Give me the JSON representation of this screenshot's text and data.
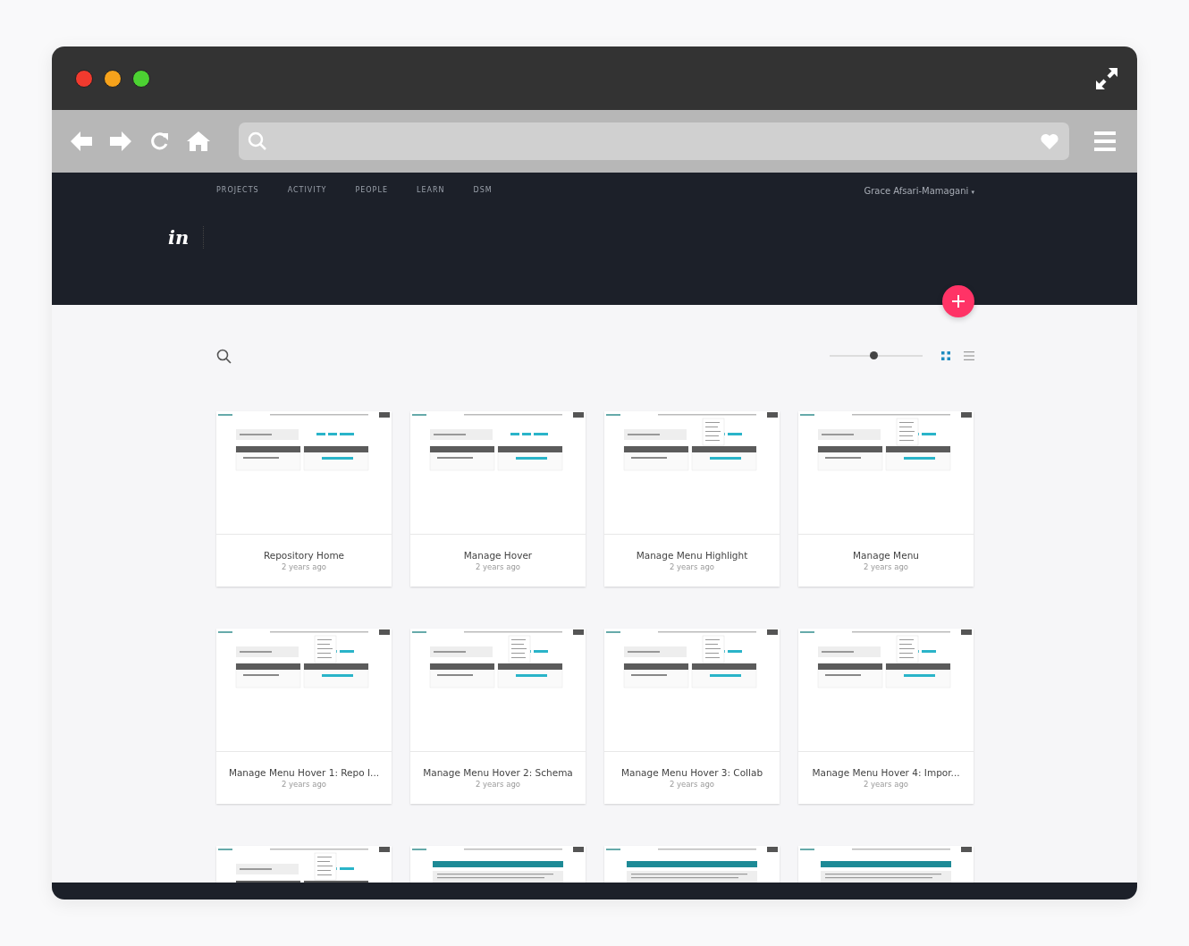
{
  "nav": {
    "items": [
      {
        "label": "PROJECTS"
      },
      {
        "label": "ACTIVITY"
      },
      {
        "label": "PEOPLE"
      },
      {
        "label": "LEARN"
      },
      {
        "label": "DSM"
      }
    ],
    "user": "Grace Afsari-Mamagani",
    "user_caret": "▾"
  },
  "logo": "in",
  "toolbar": {
    "zoom_slider": {
      "level": 0.47
    },
    "views": [
      {
        "kind": "grid",
        "selected": true
      },
      {
        "kind": "list",
        "selected": false
      }
    ]
  },
  "screens": [
    {
      "title": "Repository Home",
      "time": "2 years ago",
      "kind": "home"
    },
    {
      "title": "Manage Hover",
      "time": "2 years ago",
      "kind": "home"
    },
    {
      "title": "Manage Menu Highlight",
      "time": "2 years ago",
      "kind": "menu"
    },
    {
      "title": "Manage Menu",
      "time": "2 years ago",
      "kind": "menu"
    },
    {
      "title": "Manage Menu Hover 1: Repo I...",
      "time": "2 years ago",
      "kind": "menu"
    },
    {
      "title": "Manage Menu Hover 2: Schema",
      "time": "2 years ago",
      "kind": "menu"
    },
    {
      "title": "Manage Menu Hover 3: Collab",
      "time": "2 years ago",
      "kind": "menu"
    },
    {
      "title": "Manage Menu Hover 4: Impor...",
      "time": "2 years ago",
      "kind": "menu"
    },
    {
      "kind": "menu"
    },
    {
      "kind": "banner"
    },
    {
      "kind": "banner"
    },
    {
      "kind": "banner"
    }
  ]
}
